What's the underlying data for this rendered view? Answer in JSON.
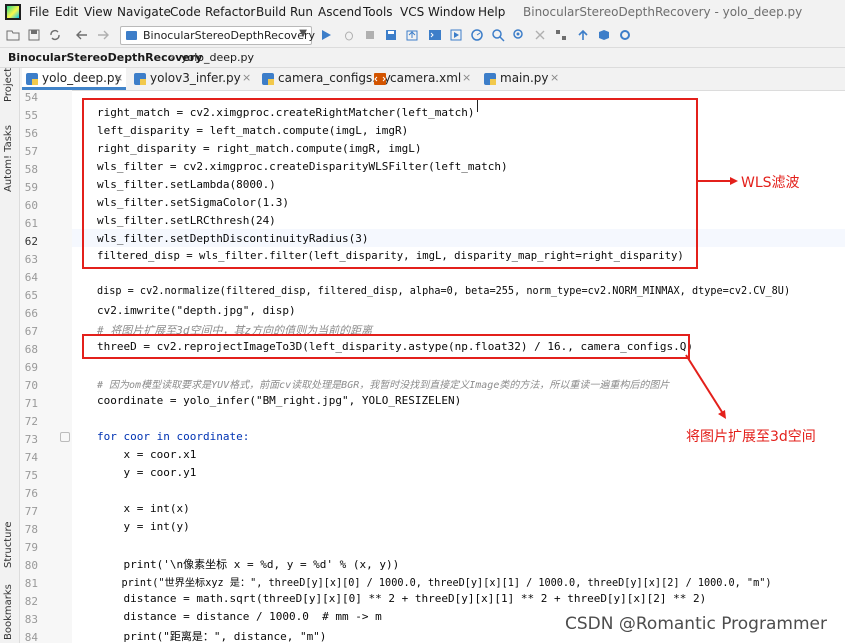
{
  "menu": [
    "File",
    "Edit",
    "View",
    "Navigate",
    "Code",
    "Refactor",
    "Build",
    "Run",
    "Ascend",
    "Tools",
    "VCS",
    "Window",
    "Help"
  ],
  "window_title": "BinocularStereoDepthRecovery - yolo_deep.py",
  "run_config": "BinocularStereoDepthRecovery",
  "breadcrumb": {
    "project": "BinocularStereoDepthRecovery",
    "file": "yolo_deep.py"
  },
  "tabs": [
    {
      "label": "yolo_deep.py",
      "close": "×",
      "active": true,
      "icon": "python-file-icon"
    },
    {
      "label": "yolov3_infer.py",
      "close": "×",
      "active": false,
      "icon": "python-file-icon"
    },
    {
      "label": "camera_configs.py",
      "close": "×",
      "active": false,
      "icon": "python-file-icon"
    },
    {
      "label": "camera.xml",
      "close": "×",
      "active": false,
      "icon": "xml-file-icon"
    },
    {
      "label": "main.py",
      "close": "×",
      "active": false,
      "icon": "python-file-icon"
    }
  ],
  "side_panels": {
    "project": "Project",
    "todo": "Autom! Tasks",
    "structure": "Structure",
    "bookmarks": "Bookmarks"
  },
  "line_numbers": [
    "54",
    "55",
    "56",
    "57",
    "58",
    "59",
    "60",
    "61",
    "62",
    "63",
    "64",
    "65",
    "66",
    "67",
    "68",
    "69",
    "70",
    "71",
    "72",
    "73",
    "74",
    "75",
    "76",
    "77",
    "78",
    "79",
    "80",
    "81",
    "82",
    "83",
    "84"
  ],
  "code": {
    "l55": "right_match = cv2.ximgproc.createRightMatcher(left_match)",
    "l56": "left_disparity = left_match.compute(imgL, imgR)",
    "l57": "right_disparity = right_match.compute(imgR, imgL)",
    "l58": "wls_filter = cv2.ximgproc.createDisparityWLSFilter(left_match)",
    "l59": "wls_filter.setLambda(8000.)",
    "l60": "wls_filter.setSigmaColor(1.3)",
    "l61": "wls_filter.setLRCthresh(24)",
    "l62": "wls_filter.setDepthDiscontinuityRadius(3)",
    "l63": "filtered_disp = wls_filter.filter(left_disparity, imgL, disparity_map_right=right_disparity)",
    "l65": "disp = cv2.normalize(filtered_disp, filtered_disp, alpha=0, beta=255, norm_type=cv2.NORM_MINMAX, dtype=cv2.CV_8U)",
    "l66": "cv2.imwrite(\"depth.jpg\", disp)",
    "l67": "# 将图片扩展至3d空间中，其z方向的值则为当前的距离",
    "l68": "threeD = cv2.reprojectImageTo3D(left_disparity.astype(np.float32) / 16., camera_configs.Q)",
    "l70": "# 因为om模型读取要求是YUV格式，前面cv读取处理是BGR，我暂时没找到直接定义Image类的方法，所以重读一遍重构后的图片",
    "l71": "coordinate = yolo_infer(\"BM_right.jpg\", YOLO_RESIZELEN)",
    "l73": "for coor in coordinate:",
    "l74": "    x = coor.x1",
    "l75": "    y = coor.y1",
    "l77": "    x = int(x)",
    "l78": "    y = int(y)",
    "l80": "    print('\\n像素坐标 x = %d, y = %d' % (x, y))",
    "l81": "    print(\"世界坐标xyz 是：\", threeD[y][x][0] / 1000.0, threeD[y][x][1] / 1000.0, threeD[y][x][2] / 1000.0, \"m\")",
    "l82": "    distance = math.sqrt(threeD[y][x][0] ** 2 + threeD[y][x][1] ** 2 + threeD[y][x][2] ** 2)",
    "l83": "    distance = distance / 1000.0  # mm -> m",
    "l84": "    print(\"距离是：\", distance, \"m\")"
  },
  "annotations": {
    "wls": "WLS滤波",
    "reproject": "将图片扩展至3d空间"
  },
  "watermark": "CSDN @Romantic Programmer",
  "colors": {
    "annotation_red": "#e3201b",
    "keyword": "#0033b3",
    "function": "#1750eb",
    "string": "#067d17",
    "comment": "#8c8c8c"
  }
}
